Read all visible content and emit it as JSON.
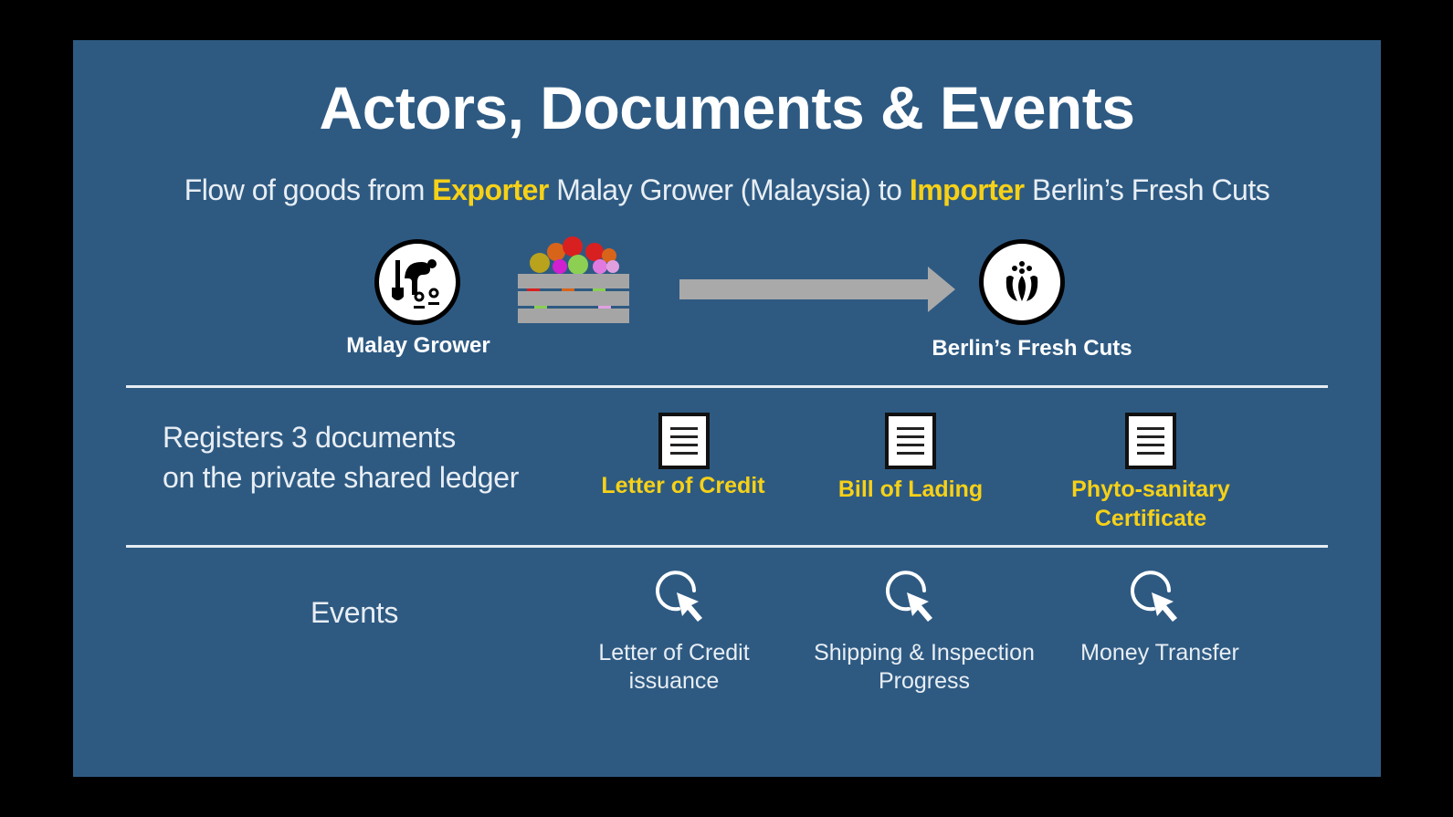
{
  "slide": {
    "title": "Actors, Documents & Events",
    "subtitle": {
      "prefix": "Flow of goods from ",
      "exporter_tag": "Exporter",
      "exporter_name": " Malay Grower (Malaysia) to ",
      "importer_tag": "Importer",
      "importer_name": " Berlin’s Fresh Cuts"
    },
    "actors": [
      {
        "name": "Malay Grower",
        "icon": "gardener-icon"
      },
      {
        "name": "Berlin’s Fresh Cuts",
        "icon": "tulip-icon"
      }
    ],
    "goods_icon": "flower-crate-icon",
    "flow_arrow_icon": "right-arrow-icon",
    "documents_row": {
      "label_line1": "Registers 3 documents",
      "label_line2": "on the private shared ledger",
      "items": [
        {
          "label": "Letter of Credit",
          "icon": "document-icon"
        },
        {
          "label": "Bill of Lading",
          "icon": "document-icon"
        },
        {
          "label_line1": "Phyto-sanitary",
          "label_line2": "Certificate",
          "icon": "document-icon"
        }
      ]
    },
    "events_row": {
      "label": "Events",
      "items": [
        {
          "label_line1": "Letter of Credit",
          "label_line2": "issuance",
          "icon": "click-cursor-icon"
        },
        {
          "label_line1": "Shipping & Inspection",
          "label_line2": "Progress",
          "icon": "click-cursor-icon"
        },
        {
          "label_line1": "Money Transfer",
          "label_line2": "",
          "icon": "click-cursor-icon"
        }
      ]
    },
    "colors": {
      "background": "#2e5a82",
      "highlight": "#f7d117",
      "text": "#ffffff",
      "arrow": "#a9a9a9"
    }
  }
}
